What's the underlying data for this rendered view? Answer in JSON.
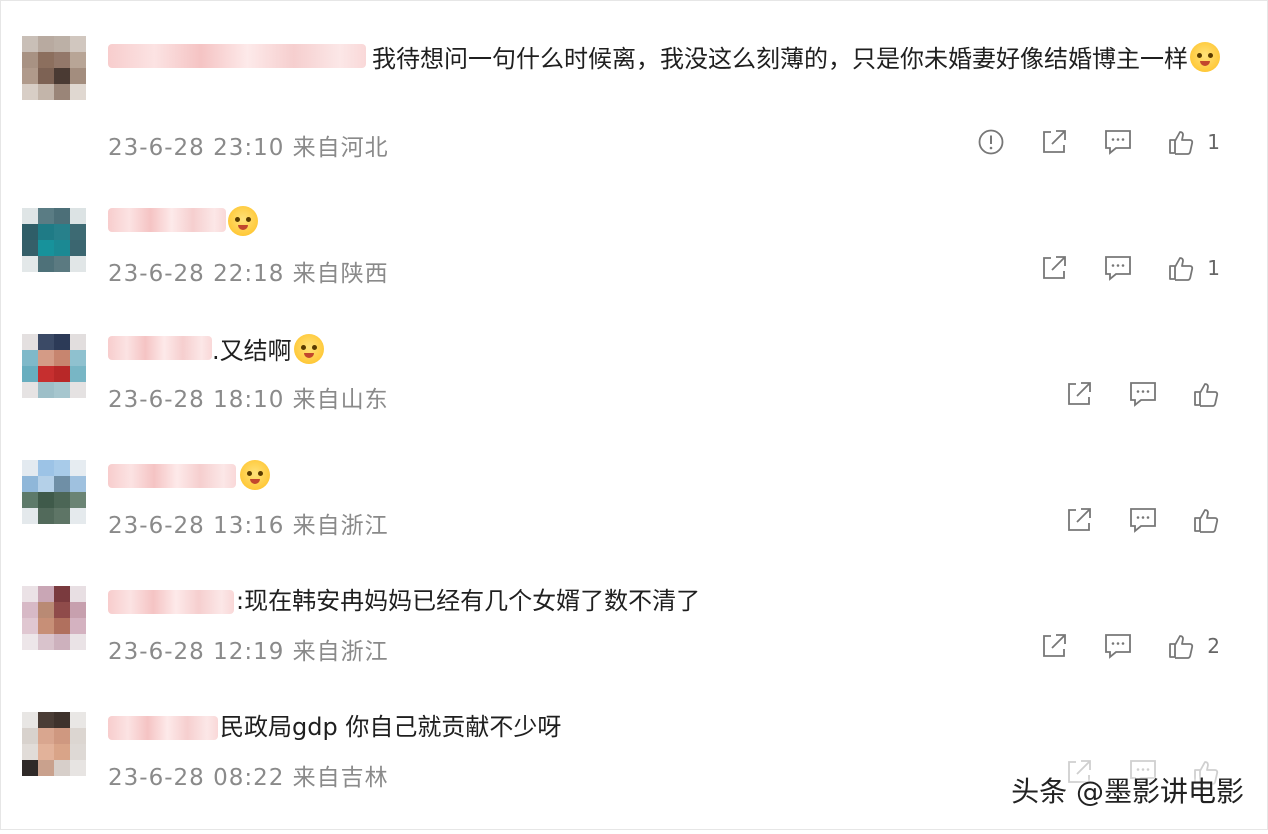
{
  "comments": [
    {
      "text": "我待想问一句什么时候离，我没这么刻薄的，只是你未婚妻好像结婚博主一样",
      "emoji": "cat-face-emoji",
      "date": "23-6-28 23:10",
      "location": "来自河北",
      "likes": "1",
      "has_report": true,
      "has_like": true
    },
    {
      "text": "",
      "emoji": "grin-emoji",
      "date": "23-6-28 22:18",
      "location": "来自陕西",
      "likes": "1",
      "has_report": false,
      "has_like": true
    },
    {
      "text": ".又结啊",
      "emoji": "cat-face-emoji",
      "date": "23-6-28 18:10",
      "location": "来自山东",
      "likes": "",
      "has_report": false,
      "has_like": true
    },
    {
      "text": "",
      "emoji": "laugh-cry-emoji",
      "date": "23-6-28 13:16",
      "location": "来自浙江",
      "likes": "",
      "has_report": false,
      "has_like": true
    },
    {
      "text": ":现在韩安冉妈妈已经有几个女婿了数不清了",
      "emoji": "",
      "date": "23-6-28 12:19",
      "location": "来自浙江",
      "likes": "2",
      "has_report": false,
      "has_like": true
    },
    {
      "text": "民政局gdp 你自己就贡献不少呀",
      "emoji": "",
      "date": "23-6-28 08:22",
      "location": "来自吉林",
      "likes": "",
      "has_report": false,
      "has_like": true
    }
  ],
  "watermark": "头条 @墨影讲电影",
  "colors": {
    "meta": "#8a8a8a",
    "icon": "#777777",
    "text": "#1f1f1f"
  }
}
